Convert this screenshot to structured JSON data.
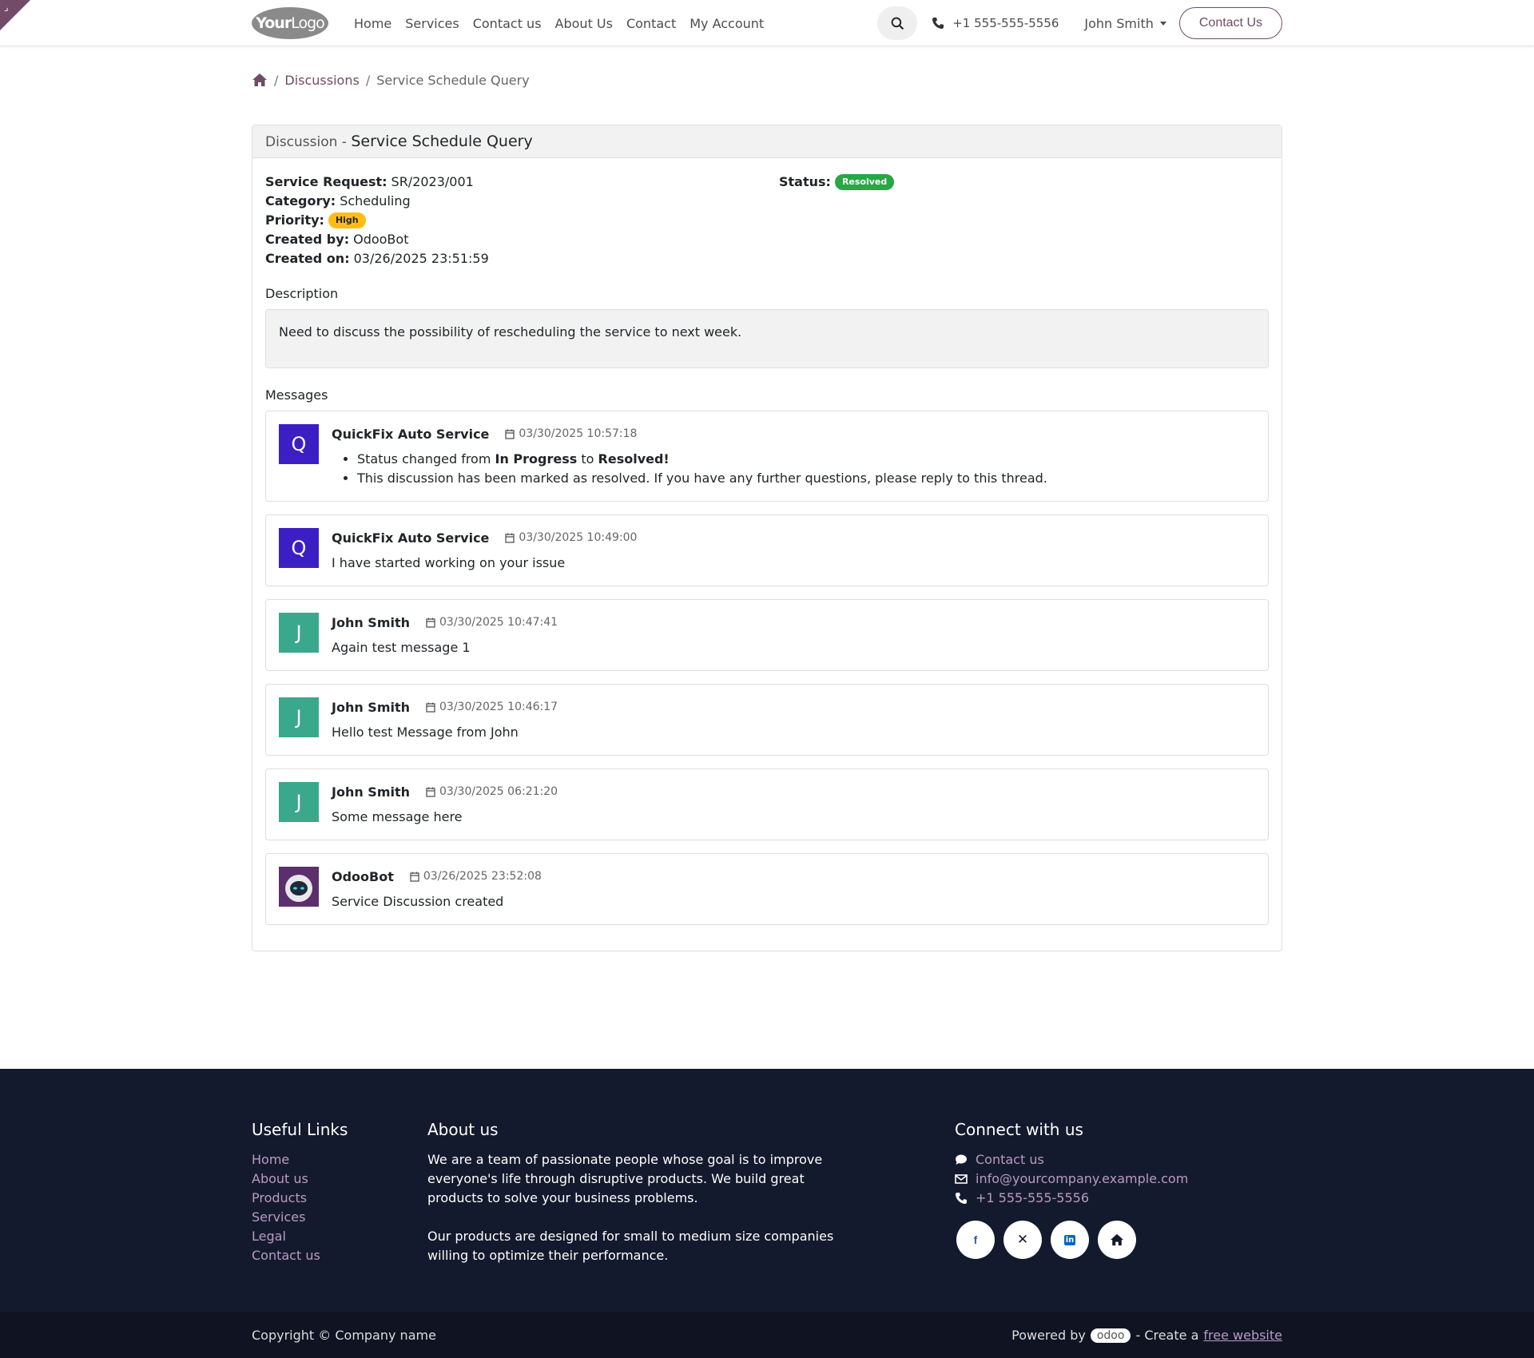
{
  "header": {
    "logo_bold": "Your",
    "logo_light": "Logo",
    "nav": [
      "Home",
      "Services",
      "Contact us",
      "About Us",
      "Contact",
      "My Account"
    ],
    "phone": "+1 555-555-5556",
    "user": "John Smith",
    "cta": "Contact Us"
  },
  "breadcrumb": {
    "items": [
      "Discussions",
      "Service Schedule Query"
    ]
  },
  "discussion": {
    "header_prefix": "Discussion - ",
    "title": "Service Schedule Query",
    "service_request_label": "Service Request:",
    "service_request": "SR/2023/001",
    "category_label": "Category:",
    "category": "Scheduling",
    "priority_label": "Priority:",
    "priority": "High",
    "created_by_label": "Created by:",
    "created_by": "OdooBot",
    "created_on_label": "Created on:",
    "created_on": "03/26/2025 23:51:59",
    "status_label": "Status:",
    "status": "Resolved",
    "description_label": "Description",
    "description": "Need to discuss the possibility of rescheduling the service to next week.",
    "messages_label": "Messages"
  },
  "messages": [
    {
      "author": "QuickFix Auto Service",
      "initial": "Q",
      "date": "03/30/2025 10:57:18",
      "avatar_color": "#3c1fc4",
      "bullets": [
        {
          "pre": "Status changed from ",
          "b1": "In Progress",
          "mid": " to ",
          "b2": "Resolved!"
        },
        {
          "text": "This discussion has been marked as resolved. If you have any further questions, please reply to this thread."
        }
      ]
    },
    {
      "author": "QuickFix Auto Service",
      "initial": "Q",
      "date": "03/30/2025 10:49:00",
      "avatar_color": "#3c1fc4",
      "text": "I have started working on your issue"
    },
    {
      "author": "John Smith",
      "initial": "J",
      "date": "03/30/2025 10:47:41",
      "avatar_color": "#3aa88a",
      "text": "Again test message 1"
    },
    {
      "author": "John Smith",
      "initial": "J",
      "date": "03/30/2025 10:46:17",
      "avatar_color": "#3aa88a",
      "text": "Hello test Message from John"
    },
    {
      "author": "John Smith",
      "initial": "J",
      "date": "03/30/2025 06:21:20",
      "avatar_color": "#3aa88a",
      "text": "Some message here"
    },
    {
      "author": "OdooBot",
      "initial": "",
      "date": "03/26/2025 23:52:08",
      "avatar_color": "#5b2f6b",
      "text": "Service Discussion created"
    }
  ],
  "footer": {
    "useful_title": "Useful Links",
    "useful_links": [
      "Home",
      "About us",
      "Products",
      "Services",
      "Legal",
      "Contact us"
    ],
    "about_title": "About us",
    "about_p1": "We are a team of passionate people whose goal is to improve everyone's life through disruptive products. We build great products to solve your business problems.",
    "about_p2": "Our products are designed for small to medium size companies willing to optimize their performance.",
    "connect_title": "Connect with us",
    "connect_contact": "Contact us",
    "connect_email": "info@yourcompany.example.com",
    "connect_phone": "+1 555-555-5556",
    "copyright": "Copyright © Company name",
    "powered_by": "Powered by",
    "odoo": "odoo",
    "create": "- Create a",
    "free_website": "free website"
  },
  "colors": {
    "brand": "#714b67",
    "footer_bg": "#141a2d",
    "resolved": "#28a745",
    "high": "#ffbc17"
  }
}
